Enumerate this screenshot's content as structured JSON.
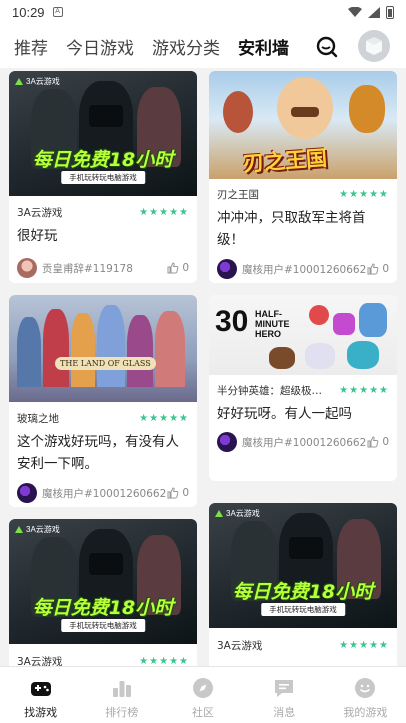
{
  "status_bar": {
    "time": "10:29",
    "notification_glyph": "A"
  },
  "top_nav": {
    "tabs": [
      {
        "label": "推荐",
        "active": false
      },
      {
        "label": "今日游戏",
        "active": false
      },
      {
        "label": "游戏分类",
        "active": false
      },
      {
        "label": "安利墙",
        "active": true
      }
    ],
    "accent_color": "#40d69f"
  },
  "cards": [
    {
      "thumb": "3a-ad",
      "ad_brand": "3A云游戏",
      "ad_banner": "每日免费18小时",
      "ad_sub": "手机玩转玩电脑游戏",
      "game_name": "3A云游戏",
      "stars": "★★★★★",
      "review": "很好玩",
      "user": "贡皇甫辞#119178",
      "likes": "0"
    },
    {
      "thumb": "blade-kingdom",
      "game_title_art": "刃之王国",
      "game_name": "刃之王国",
      "stars": "★★★★★",
      "review": "冲冲冲，只取敌军主将首级！",
      "user": "魔核用户#10001260662",
      "likes": "0"
    },
    {
      "thumb": "land-of-glass",
      "art_caption": "THE LAND OF GLASS",
      "game_name": "玻璃之地",
      "stars": "★★★★★",
      "review": "这个游戏好玩吗，有没有人安利一下啊。",
      "user": "魔核用户#10001260662",
      "likes": "0"
    },
    {
      "thumb": "half-minute-hero",
      "art_caption": "HALF-MINUTE HERO",
      "art_number": "30",
      "game_name": "半分钟英雄：超级极…",
      "stars": "★★★★★",
      "review": "好好玩呀。有人一起吗",
      "user": "魔核用户#10001260662",
      "likes": "0"
    },
    {
      "thumb": "3a-ad",
      "ad_brand": "3A云游戏",
      "ad_banner": "每日免费18小时",
      "ad_sub": "手机玩转玩电脑游戏",
      "game_name": "3A云游戏",
      "stars": "★★★★★"
    },
    {
      "thumb": "3a-ad",
      "ad_brand": "3A云游戏",
      "ad_banner": "每日免费18小时",
      "ad_sub": "手机玩转玩电脑游戏",
      "game_name": "3A云游戏",
      "stars": "★★★★★"
    }
  ],
  "bottom_nav": [
    {
      "label": "找游戏",
      "icon": "gamepad-icon",
      "active": true
    },
    {
      "label": "排行榜",
      "icon": "ranking-icon",
      "active": false
    },
    {
      "label": "社区",
      "icon": "compass-icon",
      "active": false
    },
    {
      "label": "消息",
      "icon": "message-icon",
      "active": false
    },
    {
      "label": "我的游戏",
      "icon": "smile-icon",
      "active": false
    }
  ]
}
